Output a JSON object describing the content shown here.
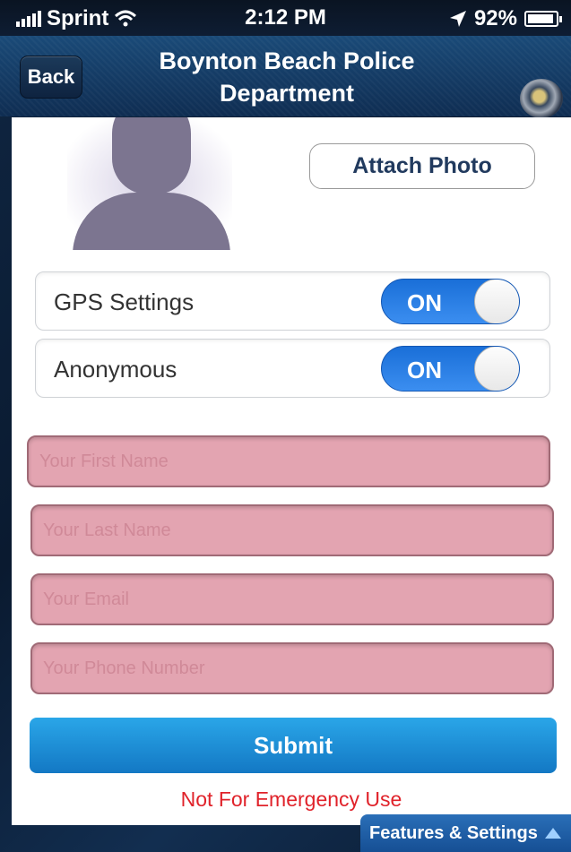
{
  "status_bar": {
    "carrier": "Sprint",
    "time": "2:12 PM",
    "battery": "92%",
    "battery_level": 0.92
  },
  "navbar": {
    "back_label": "Back",
    "title": "Boynton Beach Police Department"
  },
  "photo": {
    "attach_label": "Attach Photo"
  },
  "settings": [
    {
      "label": "GPS Settings",
      "toggle": "ON"
    },
    {
      "label": "Anonymous",
      "toggle": "ON"
    }
  ],
  "form": {
    "first_name_placeholder": "Your First Name",
    "last_name_placeholder": "Your Last Name",
    "email_placeholder": "Your Email",
    "phone_placeholder": "Your Phone Number",
    "submit_label": "Submit"
  },
  "disclaimer": "Not For Emergency Use",
  "features_tab": "Features & Settings",
  "colors": {
    "accent_blue": "#1a6fd8",
    "field_fill": "#e3a4b1",
    "submit_blue": "#1f8fd8",
    "warning_red": "#e0222a"
  }
}
